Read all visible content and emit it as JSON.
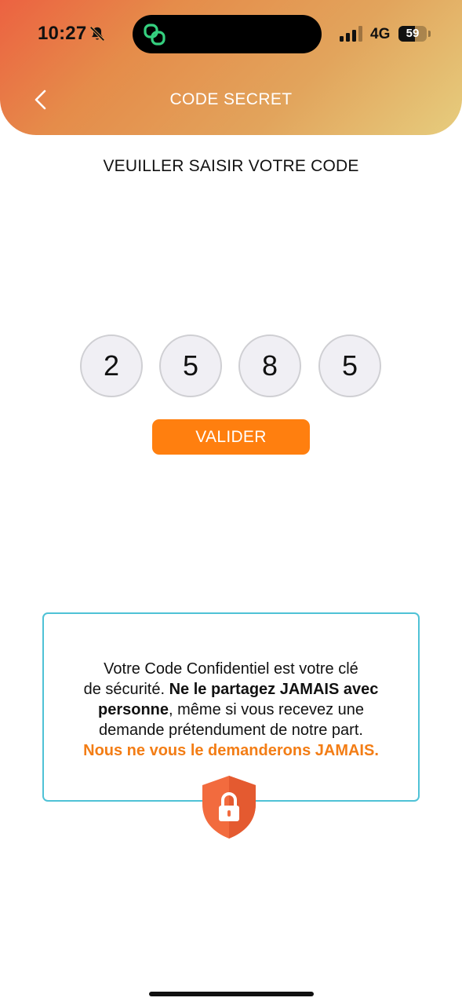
{
  "status_bar": {
    "time": "10:27",
    "network": "4G",
    "battery_level": "59",
    "battery_fraction": 0.59
  },
  "header": {
    "title": "CODE SECRET",
    "back_icon": "chevron-left-icon"
  },
  "prompt": "VEUILLER SAISIR VOTRE CODE",
  "pin_digits": [
    "2",
    "5",
    "8",
    "5"
  ],
  "submit_label": "VALIDER",
  "notice": {
    "line1": "Votre Code Confidentiel est votre clé",
    "line2_plain": "de sécurité.",
    "line2_bold": "Ne le partagez JAMAIS avec",
    "line3_bold": "personne",
    "line3_plain": ", même si vous recevez une",
    "line4": "demande prétendument de notre part.",
    "line5_orange": "Nous ne vous le demanderons JAMAIS."
  },
  "icons": {
    "silent": "bell-slash-icon",
    "island_app": "linked-rings-icon",
    "signal": "signal-bars-icon",
    "shield": "shield-lock-icon"
  },
  "colors": {
    "accent": "#ff7f0f",
    "notice_border": "#4fc2d6",
    "notice_emphasis": "#f37d15",
    "shield": "#f26b3e"
  }
}
